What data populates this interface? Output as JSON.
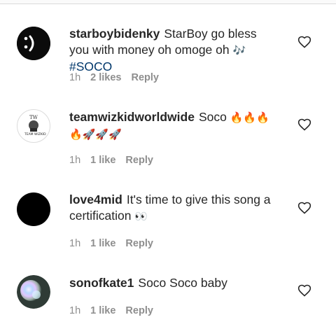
{
  "comments": [
    {
      "username": "starboybidenky",
      "text": "StarBoy go bless you with money oh omoge oh",
      "emoji": "🎶",
      "hashtag": "#SOCO",
      "time": "1h",
      "likes": "2 likes",
      "reply": "Reply",
      "avatar": "dark-logo"
    },
    {
      "username": "teamwizkidworldwide",
      "text": "Soco",
      "emoji": "🔥🔥🔥🔥🚀🚀🚀",
      "time": "1h",
      "likes": "1 like",
      "reply": "Reply",
      "avatar": "team-wizkid-logo"
    },
    {
      "username": "love4mid",
      "text": "It's time to give this song a certification",
      "emoji": "👀",
      "time": "1h",
      "likes": "1 like",
      "reply": "Reply",
      "avatar": "black-circle"
    },
    {
      "username": "sonofkate1",
      "text": "Soco Soco baby",
      "time": "1h",
      "likes": "1 like",
      "reply": "Reply",
      "avatar": "holographic"
    }
  ],
  "colors": {
    "text": "#262626",
    "meta": "#8e8e8e",
    "hashtag": "#00376b",
    "divider": "#dbdbdb"
  }
}
